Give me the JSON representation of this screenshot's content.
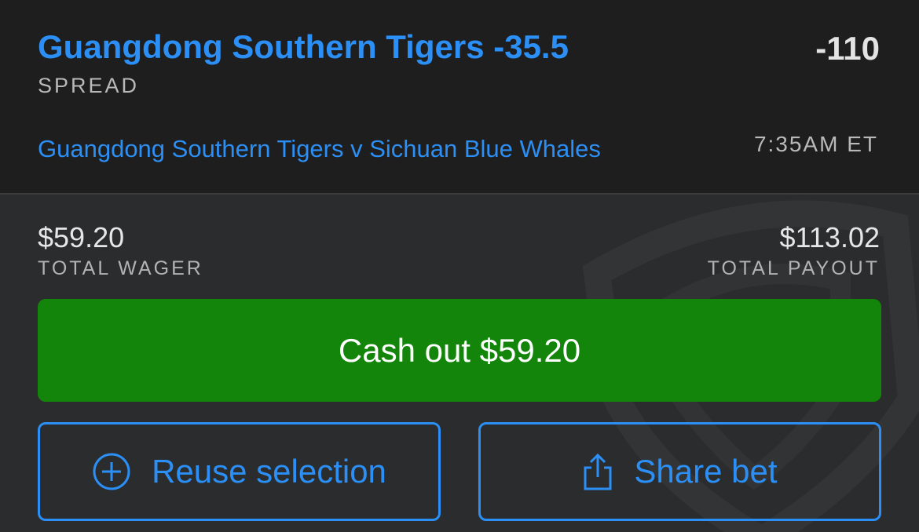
{
  "selection": {
    "title": "Guangdong Southern Tigers -35.5",
    "odds": "-110",
    "market": "SPREAD",
    "event": "Guangdong Southern Tigers v Sichuan Blue Whales",
    "time": "7:35AM ET"
  },
  "bet": {
    "wager_amount": "$59.20",
    "wager_label": "TOTAL WAGER",
    "payout_amount": "$113.02",
    "payout_label": "TOTAL PAYOUT"
  },
  "actions": {
    "cashout_label": "Cash out $59.20",
    "reuse_label": "Reuse selection",
    "reuse_icon": "plus-circle-icon",
    "share_label": "Share bet",
    "share_icon": "share-icon"
  },
  "colors": {
    "accent_blue": "#2b8ff5",
    "cashout_green": "#13850a",
    "panel_dark": "#1e1e1f",
    "panel_gray": "#2b2c2e"
  }
}
